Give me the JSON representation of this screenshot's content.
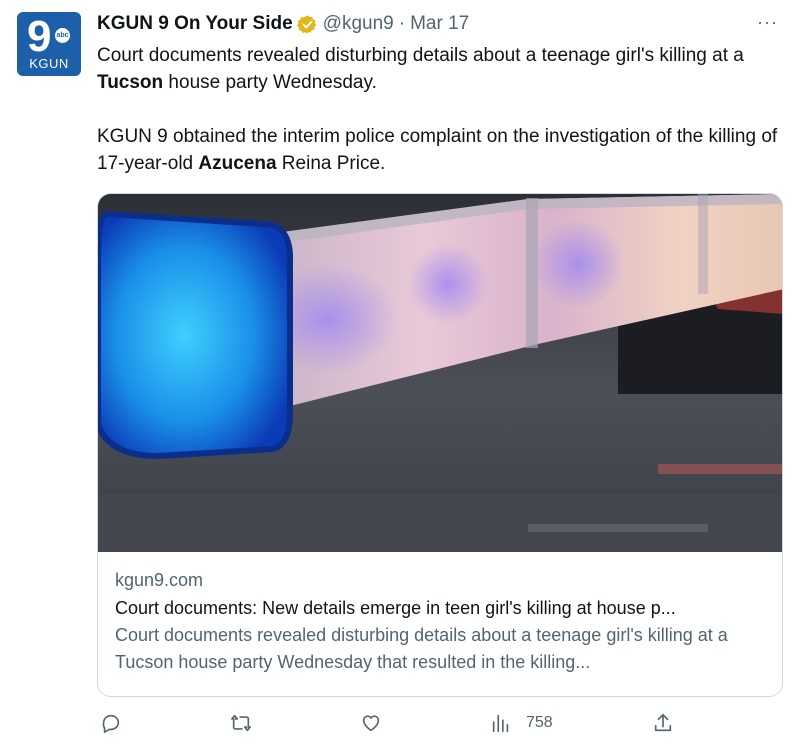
{
  "account": {
    "avatar_number": "9",
    "avatar_network": "abc",
    "avatar_station": "KGUN",
    "display_name": "KGUN 9 On Your Side",
    "handle": "@kgun9",
    "separator": "·",
    "date": "Mar 17",
    "verified_badge_color": "#e2b719"
  },
  "menu": {
    "more_label": "···"
  },
  "tweet": {
    "p1_before": "Court documents revealed disturbing details about a teenage girl's killing at a ",
    "p1_bold": "Tucson",
    "p1_after": " house party Wednesday.",
    "p2_before": "KGUN 9 obtained the interim police complaint on the investigation of the killing of 17-year-old ",
    "p2_bold": "Azucena",
    "p2_after": " Reina Price."
  },
  "card": {
    "image_icon": "police-light-bar-photo",
    "domain": "kgun9.com",
    "title": "Court documents: New details emerge in teen girl's killing at house p...",
    "description": "Court documents revealed disturbing details about a teenage girl's killing at a Tucson house party Wednesday that resulted in the killing..."
  },
  "actions": {
    "reply_icon": "reply-icon",
    "retweet_icon": "retweet-icon",
    "like_icon": "heart-icon",
    "views_icon": "analytics-icon",
    "views_count": "758",
    "share_icon": "share-icon"
  },
  "colors": {
    "text_primary": "#0f1419",
    "text_secondary": "#536471",
    "border": "#cfd9de",
    "avatar_bg": "#1d5fa8"
  }
}
